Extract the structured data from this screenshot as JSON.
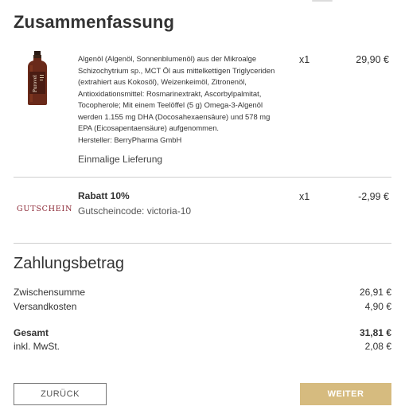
{
  "summary": {
    "title": "Zusammenfassung"
  },
  "product": {
    "brand_label": "Purovel",
    "description_lines": [
      "Algenöl (Algenöl, Sonnenblumenöl) aus der Mikroalge",
      "Schizochytrium sp., MCT Öl aus mittelkettigen Triglyceriden",
      "(extrahiert aus Kokosöl), Weizenkeimöl, Zitronenöl,",
      "Antioxidationsmittel: Rosmarinextrakt, Ascorbylpalmitat,",
      "Tocopherole; Mit einem Teelöffel (5 g) Omega-3-Algenöl",
      "werden 1.155 mg DHA (Docosahexaensäure) und 578 mg",
      "EPA (Eicosapentaensäure) aufgenommen.",
      "Hersteller: BerryPharma GmbH"
    ],
    "quantity": "x1",
    "price": "29,90 €",
    "delivery": "Einmalige Lieferung"
  },
  "discount": {
    "logo_text": "GUTSCHEIN",
    "title": "Rabatt 10%",
    "code": "Gutscheincode: victoria-10",
    "quantity": "x1",
    "price": "-2,99 €"
  },
  "payment": {
    "title": "Zahlungsbetrag",
    "subtotal_label": "Zwischensumme",
    "subtotal_value": "26,91 €",
    "shipping_label": "Versandkosten",
    "shipping_value": "4,90 €",
    "total_label": "Gesamt",
    "total_value": "31,81 €",
    "vat_label": "inkl. MwSt.",
    "vat_value": "2,08 €"
  },
  "buttons": {
    "back": "ZURÜCK",
    "next": "WEITER"
  },
  "colors": {
    "accent": "#d6bb7f",
    "voucher_logo": "#8a2432",
    "divider": "#cfcfcf"
  }
}
